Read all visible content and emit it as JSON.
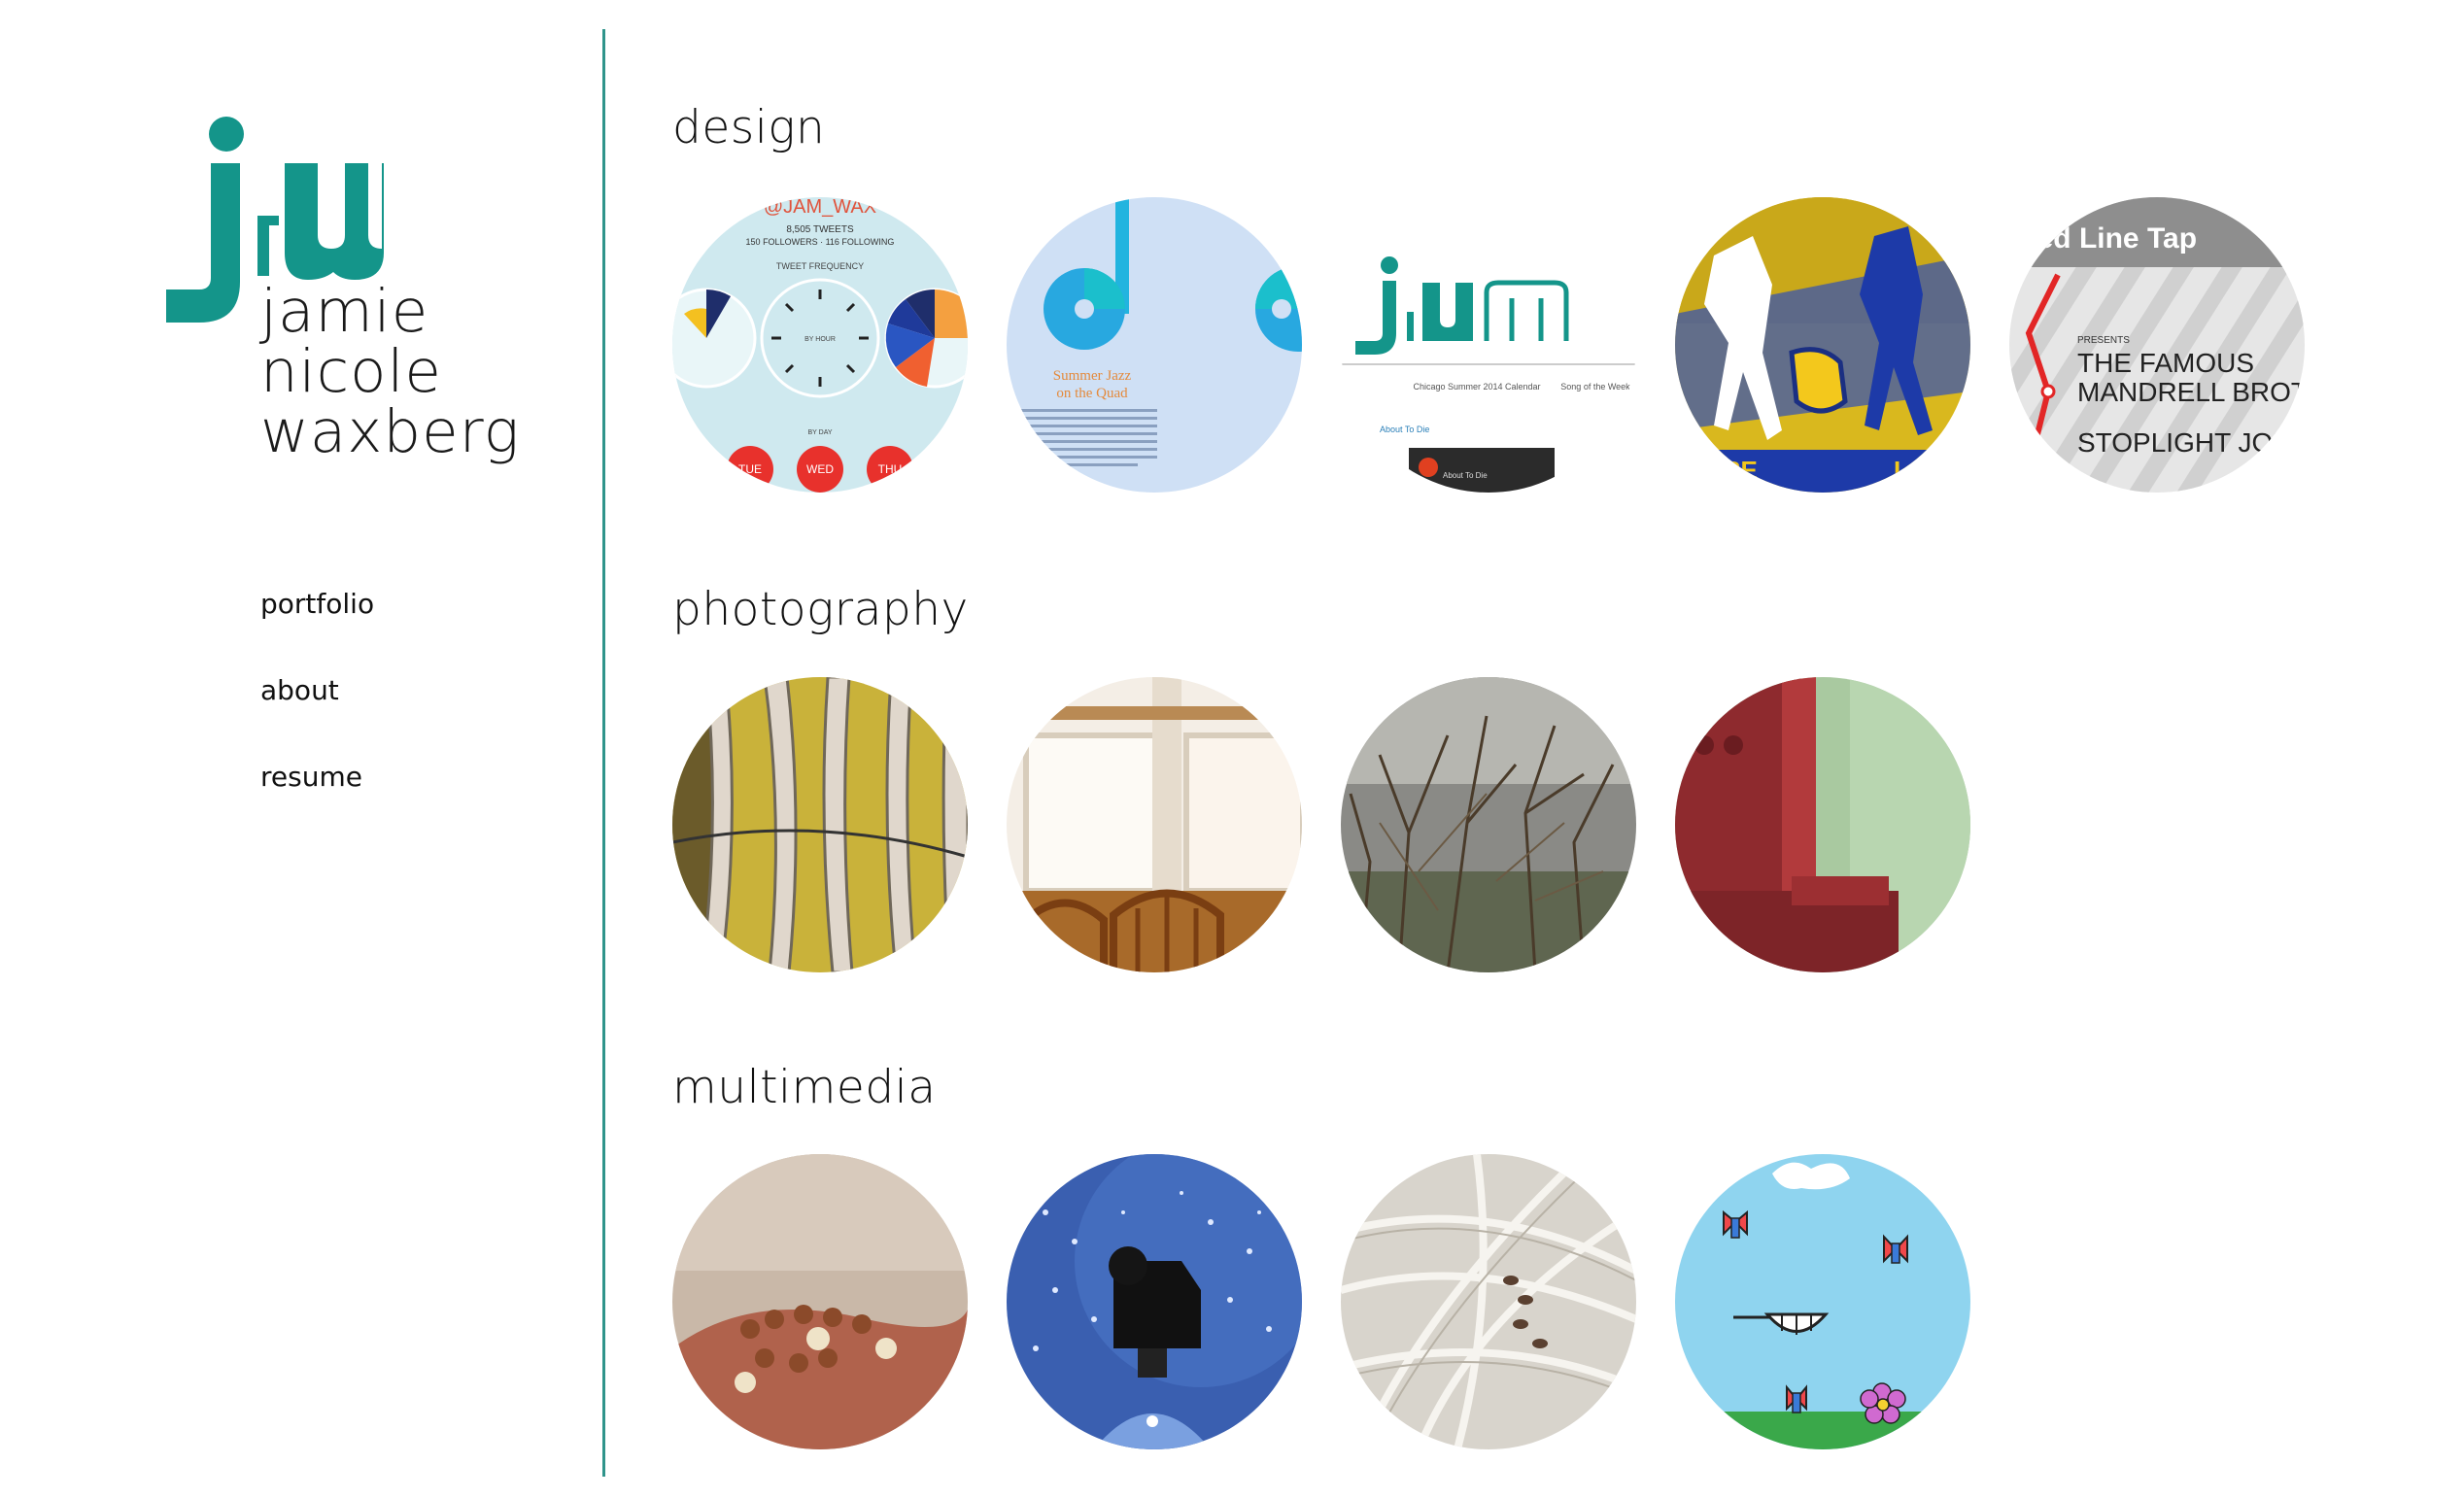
{
  "brand": {
    "monogram": "jnw",
    "name_lines": [
      "jamie",
      "nicole",
      "waxberg"
    ],
    "accent_color": "#14958a"
  },
  "nav": {
    "items": [
      {
        "label": "portfolio"
      },
      {
        "label": "about"
      },
      {
        "label": "resume"
      }
    ]
  },
  "sections": [
    {
      "title": "design",
      "items": [
        {
          "name": "twitter-infographic",
          "texts": [
            "@JAM_WAX",
            "8,505 TWEETS",
            "150 FOLLOWERS · 116 FOLLOWING",
            "TWEET FREQUENCY",
            "BY HOUR",
            "BY DAY",
            "TUE",
            "WED",
            "THU"
          ]
        },
        {
          "name": "summer-jazz-layout",
          "texts": [
            "Summer Jazz",
            "on the Quad"
          ]
        },
        {
          "name": "jnw-website-header",
          "texts": [
            "Chicago Summer 2014 Calendar",
            "Song of the Week",
            "About To Die"
          ]
        },
        {
          "name": "lacrosse-poster",
          "texts": [
            "ARE",
            "LA"
          ]
        },
        {
          "name": "red-line-tap-poster",
          "texts": [
            "Red Line Tap",
            "PRESENTS",
            "THE FAMOUS",
            "MANDRELL BROTHERS",
            "STOPLIGHT JONES"
          ]
        }
      ]
    },
    {
      "title": "photography",
      "items": [
        {
          "name": "cactus-photo"
        },
        {
          "name": "window-chairs-photo"
        },
        {
          "name": "bare-branches-photo"
        },
        {
          "name": "red-post-photo"
        }
      ]
    },
    {
      "title": "multimedia",
      "items": [
        {
          "name": "beads-hand-photo"
        },
        {
          "name": "camera-lights-photo"
        },
        {
          "name": "white-wires-photo"
        },
        {
          "name": "butterflies-animation"
        }
      ]
    }
  ]
}
